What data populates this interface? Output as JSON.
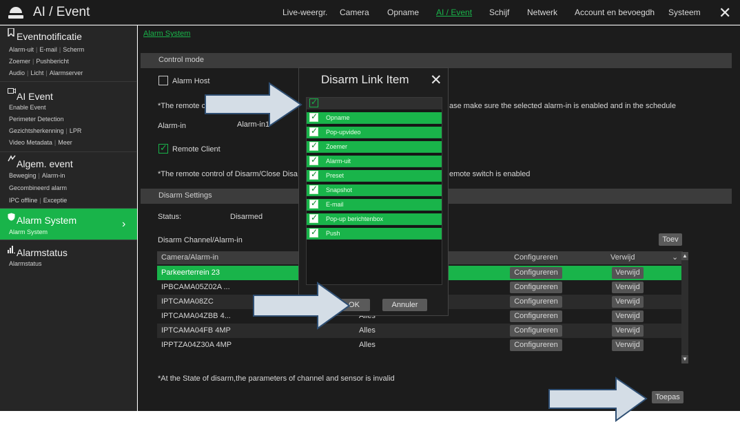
{
  "app": {
    "title": "AI / Event"
  },
  "nav": {
    "items": [
      "Live-weergr.",
      "Camera",
      "Opname",
      "AI / Event",
      "Schijf",
      "Netwerk",
      "Account en bevoegdh",
      "Systeem"
    ],
    "active": "AI / Event"
  },
  "sidebar": {
    "groups": [
      {
        "title": "Eventnotificatie",
        "icon": "bookmark-icon",
        "lines": [
          [
            "Alarm-uit",
            "E-mail",
            "Scherm"
          ],
          [
            "Zoemer",
            "Pushbericht"
          ],
          [
            "Audio",
            "Licht",
            "Alarmserver"
          ]
        ]
      },
      {
        "title": "AI Event",
        "icon": "ai-camera-icon",
        "lines": [
          [
            "Enable Event"
          ],
          [
            "Perimeter Detection"
          ],
          [
            "Gezichtsherkenning",
            "LPR"
          ],
          [
            "Video Metadata",
            "Meer"
          ]
        ]
      },
      {
        "title": "Algem. event",
        "icon": "general-event-icon",
        "lines": [
          [
            "Beweging",
            "Alarm-in"
          ],
          [
            "Gecombineerd alarm"
          ],
          [
            "IPC offline",
            "Exceptie"
          ]
        ]
      },
      {
        "title": "Alarm System",
        "icon": "shield-icon",
        "lines": [
          [
            "Alarm System"
          ]
        ],
        "active": true
      },
      {
        "title": "Alarmstatus",
        "icon": "bar-chart-icon",
        "lines": [
          [
            "Alarmstatus"
          ]
        ]
      }
    ]
  },
  "main": {
    "breadcrumb": "Alarm System",
    "control_mode": "Control mode",
    "alarm_host": "Alarm Host",
    "remote_note_prefix": "*The remote c",
    "remote_note_suffix": "ase make sure the selected alarm-in is enabled and in the schedule",
    "alarm_in_label": "Alarm-in",
    "alarm_in_value": "Alarm-in1",
    "remote_client": "Remote Client",
    "remote_control_prefix": "*The remote control of Disarm/Close Disa",
    "remote_control_suffix": "emote switch is enabled",
    "disarm_settings": "Disarm Settings",
    "status_label": "Status:",
    "status_value": "Disarmed",
    "disarm_channel": "Disarm Channel/Alarm-in",
    "add_button": "Toev",
    "footnote": "*At the State of disarm,the parameters of channel and sensor is invalid",
    "apply_button": "Toepas"
  },
  "table": {
    "headers": {
      "camera": "Camera/Alarm-in",
      "configure": "Configureren",
      "delete": "Verwijd"
    },
    "rows": [
      {
        "camera": "Parkeerterrein 23",
        "value": "",
        "configure": "Configureren",
        "delete": "Verwijd",
        "selected": true
      },
      {
        "camera": "IPBCAMA05Z02A ...",
        "value": "",
        "configure": "Configureren",
        "delete": "Verwijd"
      },
      {
        "camera": "IPTCAMA08ZC",
        "value": "",
        "configure": "Configureren",
        "delete": "Verwijd"
      },
      {
        "camera": "IPTCAMA04ZBB 4...",
        "value": "Alles",
        "configure": "Configureren",
        "delete": "Verwijd"
      },
      {
        "camera": "IPTCAMA04FB 4MP",
        "value": "Alles",
        "configure": "Configureren",
        "delete": "Verwijd"
      },
      {
        "camera": "IPPTZA04Z30A 4MP",
        "value": "Alles",
        "configure": "Configureren",
        "delete": "Verwijd"
      }
    ]
  },
  "modal": {
    "title": "Disarm Link Item",
    "items": [
      "Opname",
      "Pop-upvideo",
      "Zoemer",
      "Alarm-uit",
      "Preset",
      "Snapshot",
      "E-mail",
      "Pop-up berichtenbox",
      "Push"
    ],
    "ok": "OK",
    "cancel": "Annuler"
  },
  "colors": {
    "accent": "#19b44a",
    "background": "#1c1c1c",
    "panel": "#262626",
    "arrow_fill": "#d4dde6",
    "arrow_stroke": "#2f4f73"
  }
}
